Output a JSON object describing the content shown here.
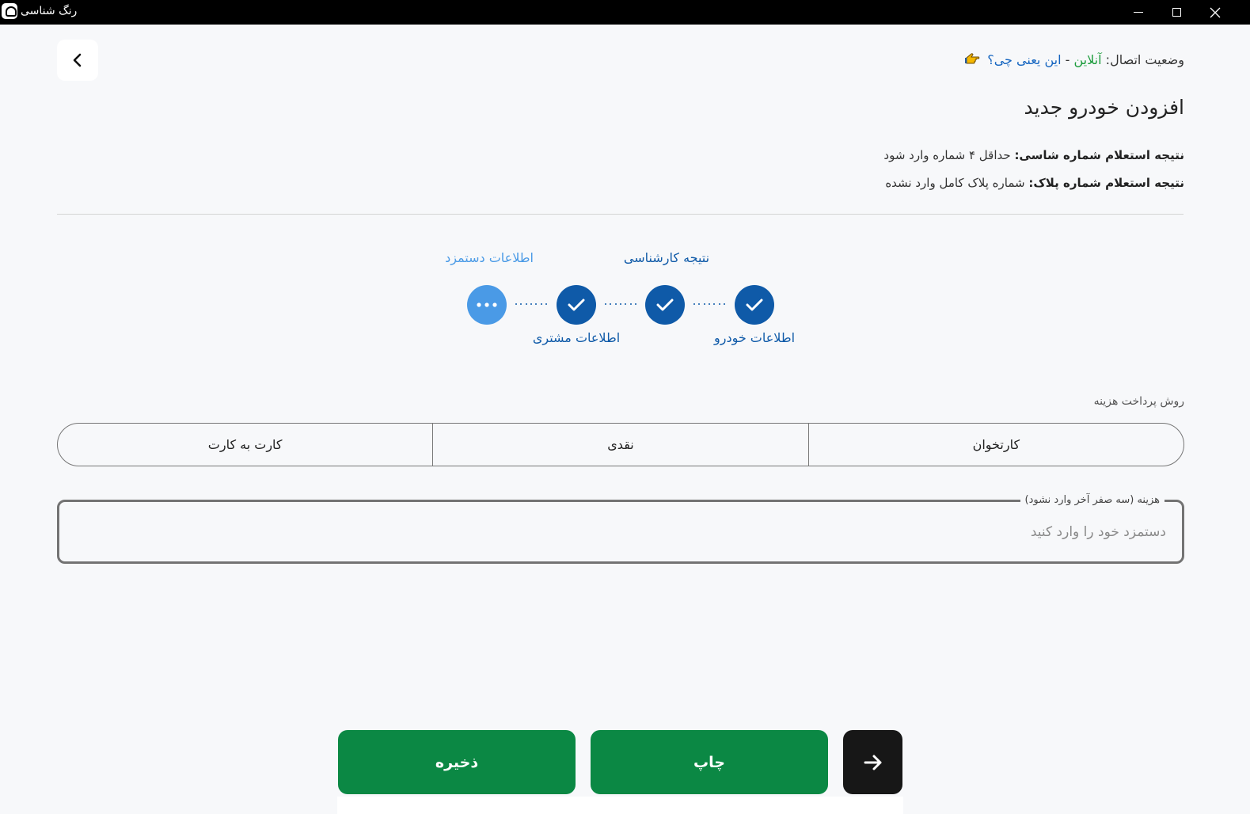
{
  "window": {
    "title": "رنگ شناسی"
  },
  "connection": {
    "label": "وضعیت اتصال:",
    "status": "آنلاین",
    "separator": "-",
    "help": "این یعنی چی؟"
  },
  "page": {
    "title": "افزودن خودرو جدید"
  },
  "inquiry": [
    {
      "label": "نتیجه استعلام شماره شاسی:",
      "value": "حداقل ۴ شماره وارد شود"
    },
    {
      "label": "نتیجه استعلام شماره پلاک:",
      "value": "شماره پلاک کامل وارد نشده"
    }
  ],
  "stepper": {
    "steps": [
      {
        "label": "اطلاعات خودرو",
        "state": "done"
      },
      {
        "label": "نتیجه کارشناسی",
        "state": "done"
      },
      {
        "label": "اطلاعات مشتری",
        "state": "done"
      },
      {
        "label": "اطلاعات دستمزد",
        "state": "current"
      }
    ]
  },
  "payment": {
    "label": "روش پرداخت هزینه",
    "options": [
      "کارتخوان",
      "نقدی",
      "کارت به کارت"
    ]
  },
  "fee": {
    "label": "هزینه (سه صفر آخر وارد نشود)",
    "placeholder": "دستمزد خود را وارد کنید",
    "value": ""
  },
  "actions": {
    "save": "ذخیره",
    "print": "چاپ",
    "next_icon": "arrow-right-icon"
  },
  "colors": {
    "primary": "#0f5aa8",
    "current_step": "#4a9ae6",
    "action": "#0b8844",
    "online": "#1a9b3a",
    "dark": "#171717"
  }
}
